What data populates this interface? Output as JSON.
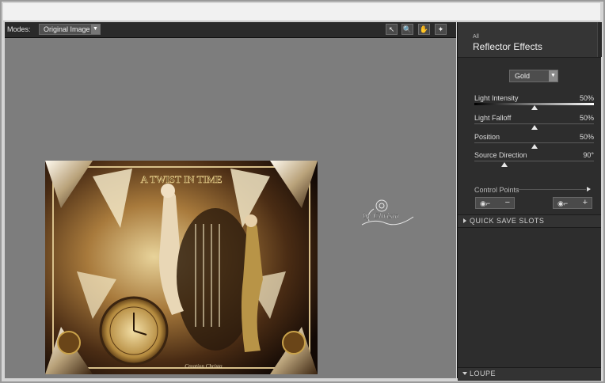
{
  "toolbar": {
    "modes_label": "Modes:",
    "mode_value": "Original Image",
    "tools": [
      {
        "icon": "arrow-pointer-icon",
        "glyph": "↖"
      },
      {
        "icon": "zoom-icon",
        "glyph": "🔍"
      },
      {
        "icon": "hand-icon",
        "glyph": "✋"
      },
      {
        "icon": "light-icon",
        "glyph": "✦"
      }
    ]
  },
  "artwork": {
    "title": "A TWIST IN TIME",
    "footer": "Creation Christa",
    "watermark": "by Christa"
  },
  "panel": {
    "breadcrumb": "All",
    "title": "Reflector Effects",
    "preset": "Gold",
    "sliders": [
      {
        "label": "Light Intensity",
        "value": "50%",
        "level": 0.5
      },
      {
        "label": "Light Falloff",
        "value": "50%",
        "level": 0.5
      },
      {
        "label": "Position",
        "value": "50%",
        "level": 0.5
      },
      {
        "label": "Source Direction",
        "value": "90°",
        "level": 0.25
      }
    ],
    "control_points_label": "Control Points",
    "minus": "−",
    "plus": "+",
    "quick_save": "QUICK SAVE SLOTS",
    "loupe": "LOUPE"
  },
  "colors": {
    "panel_bg": "#2d2d2d",
    "canvas_bg": "#7d7d7d",
    "gold": "#c9a24a"
  }
}
